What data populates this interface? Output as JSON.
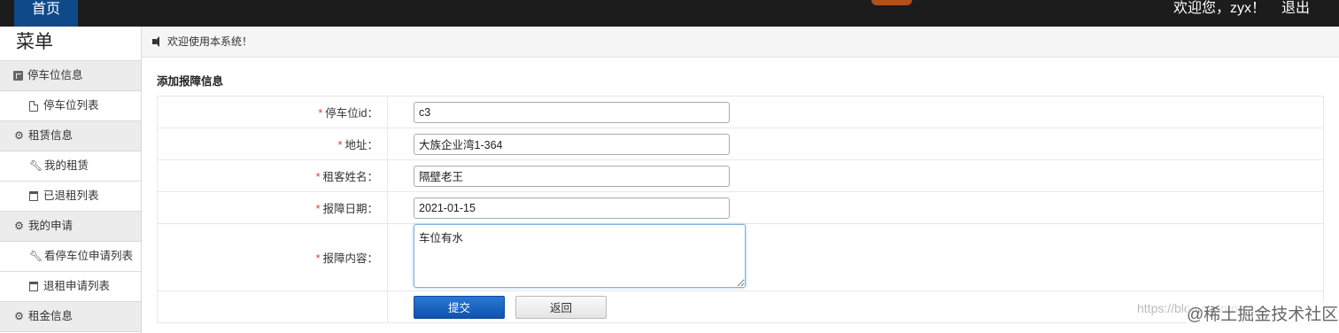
{
  "topbar": {
    "home_label": "首页",
    "welcome_text": "欢迎您，zyx！",
    "logout_label": "退出"
  },
  "sidebar": {
    "title": "菜单",
    "groups": [
      {
        "label": "停车位信息",
        "icon": "box-icon",
        "items": [
          {
            "label": "停车位列表",
            "icon": "file-icon"
          }
        ]
      },
      {
        "label": "租赁信息",
        "icon": "gear-icon",
        "items": [
          {
            "label": "我的租赁",
            "icon": "wrench-icon"
          },
          {
            "label": "已退租列表",
            "icon": "trash-icon"
          }
        ]
      },
      {
        "label": "我的申请",
        "icon": "gear-icon",
        "items": [
          {
            "label": "看停车位申请列表",
            "icon": "wrench-icon"
          },
          {
            "label": "退租申请列表",
            "icon": "trash-icon"
          }
        ]
      },
      {
        "label": "租金信息",
        "icon": "gear-icon",
        "items": []
      }
    ]
  },
  "notice": {
    "text": "欢迎使用本系统！",
    "icon": "speaker-icon"
  },
  "form": {
    "title": "添加报障信息",
    "required_mark": "*",
    "fields": [
      {
        "label": "停车位id：",
        "value": "c3"
      },
      {
        "label": "地址：",
        "value": "大族企业湾1-364"
      },
      {
        "label": "租客姓名：",
        "value": "隔壁老王"
      },
      {
        "label": "报障日期：",
        "value": "2021-01-15"
      },
      {
        "label": "报障内容：",
        "value": "车位有水"
      }
    ],
    "submit_label": "提交",
    "back_label": "返回"
  },
  "watermark": {
    "url": "https://blog.csdn.net/...",
    "brand": "@稀土掘金技术社区"
  }
}
